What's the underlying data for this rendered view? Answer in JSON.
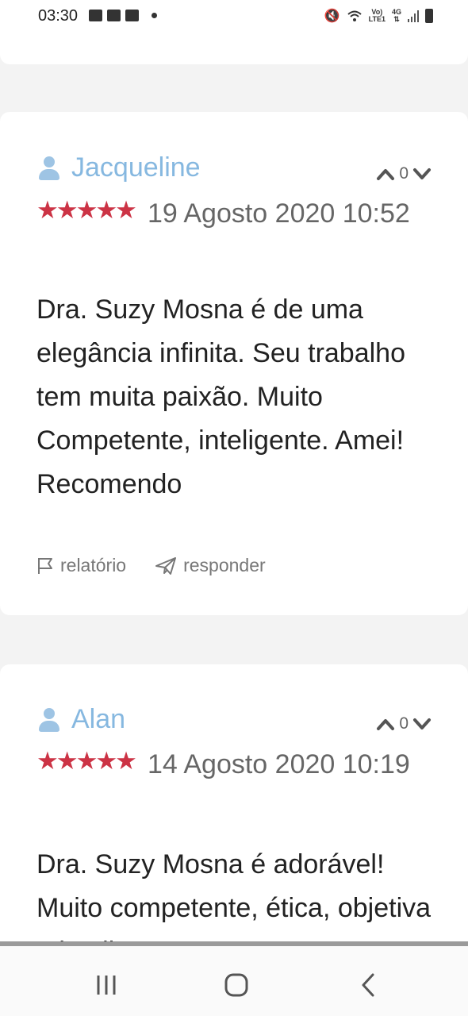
{
  "status_bar": {
    "time": "03:30",
    "network_top": "Vo)",
    "network_bottom": "LTE1",
    "signal_type": "4G"
  },
  "reviews": [
    {
      "author": "Jacqueline",
      "votes": "0",
      "stars": "★★★★★",
      "rating": 5,
      "date": "19 Agosto 2020 10:52",
      "text": "Dra. Suzy Mosna é de uma elegância infinita. Seu trabalho tem muita paixão. Muito Competente, inteligente. Amei! Recomendo",
      "report_label": "relatório",
      "reply_label": "responder"
    },
    {
      "author": "Alan",
      "votes": "0",
      "stars": "★★★★★",
      "rating": 5,
      "date": "14 Agosto 2020 10:19",
      "text": "Dra. Suzy Mosna é adorável! Muito competente, ética, objetiva e inteligente. Tem"
    }
  ],
  "icons": {
    "user": "user-icon",
    "upvote": "chevron-up-icon",
    "downvote": "chevron-down-icon",
    "report": "flag-icon",
    "reply": "paper-plane-icon"
  },
  "colors": {
    "author": "#86b8e0",
    "stars": "#cc3345",
    "background": "#f3f3f3"
  }
}
